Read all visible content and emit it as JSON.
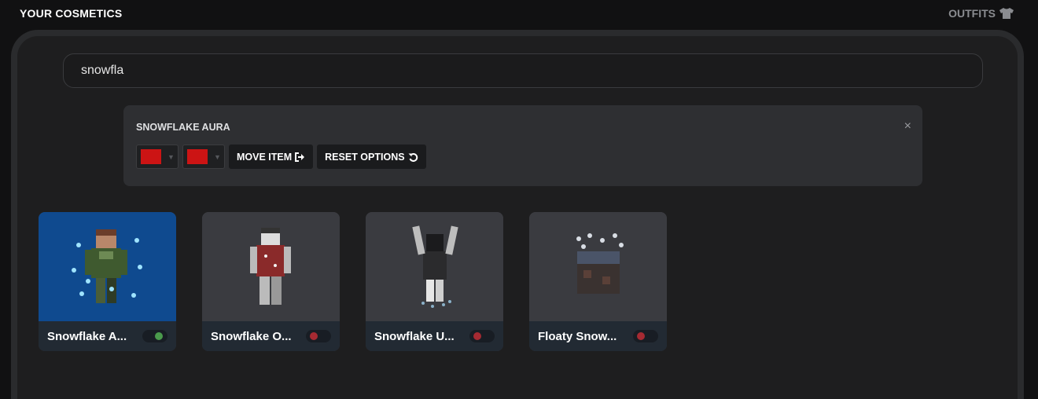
{
  "header": {
    "title": "YOUR COSMETICS",
    "outfits_label": "OUTFITS"
  },
  "search": {
    "value": "snowfla"
  },
  "options": {
    "item_title": "SNOWFLAKE AURA",
    "color1": "#cc1414",
    "color2": "#cc1414",
    "move_label": "MOVE ITEM",
    "reset_label": "RESET OPTIONS",
    "close_label": "×"
  },
  "items": [
    {
      "name": "Snowflake A...",
      "enabled": true,
      "selected": true
    },
    {
      "name": "Snowflake O...",
      "enabled": false,
      "selected": false
    },
    {
      "name": "Snowflake U...",
      "enabled": false,
      "selected": false
    },
    {
      "name": "Floaty Snow...",
      "enabled": false,
      "selected": false
    }
  ],
  "colors": {
    "selected_card": "#0f4a8f",
    "toggle_on": "#4a9a4c",
    "toggle_off": "#a52a32"
  }
}
